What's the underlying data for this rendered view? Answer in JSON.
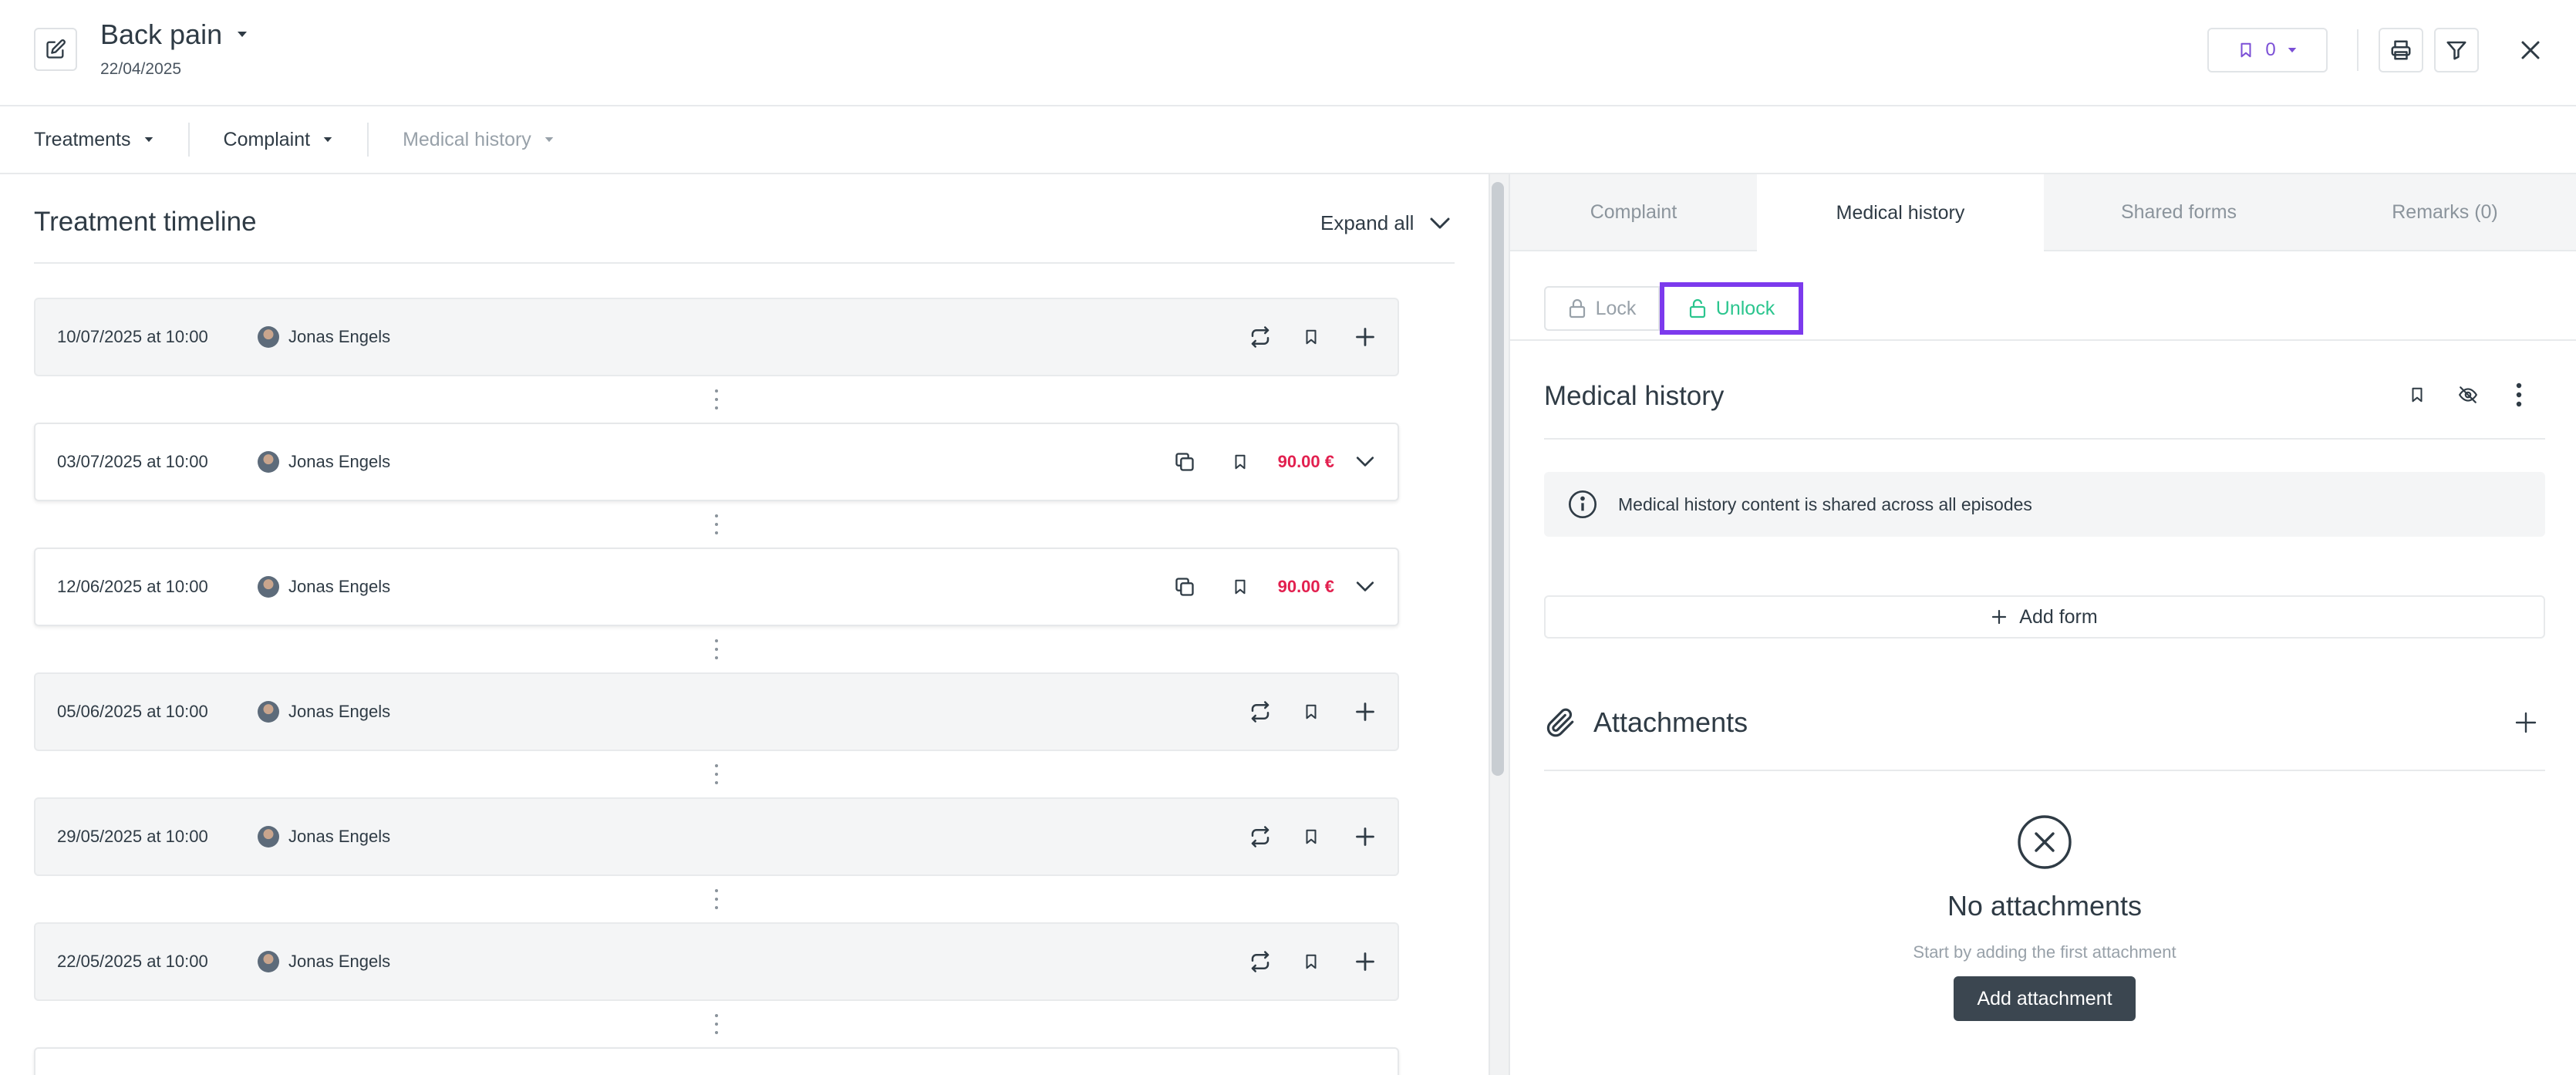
{
  "header": {
    "title": "Back pain",
    "date": "22/04/2025",
    "bookmark_count": "0"
  },
  "subnav": {
    "items": [
      {
        "label": "Treatments"
      },
      {
        "label": "Complaint"
      },
      {
        "label": "Medical history"
      }
    ]
  },
  "timeline": {
    "title": "Treatment timeline",
    "expand_all": "Expand all",
    "rows": [
      {
        "date": "10/07/2025 at 10:00",
        "practitioner": "Jonas Engels",
        "variant": "planned",
        "price": ""
      },
      {
        "date": "03/07/2025 at 10:00",
        "practitioner": "Jonas Engels",
        "variant": "done",
        "price": "90.00 €"
      },
      {
        "date": "12/06/2025 at 10:00",
        "practitioner": "Jonas Engels",
        "variant": "done",
        "price": "90.00 €"
      },
      {
        "date": "05/06/2025 at 10:00",
        "practitioner": "Jonas Engels",
        "variant": "planned",
        "price": ""
      },
      {
        "date": "29/05/2025 at 10:00",
        "practitioner": "Jonas Engels",
        "variant": "planned",
        "price": ""
      },
      {
        "date": "22/05/2025 at 10:00",
        "practitioner": "Jonas Engels",
        "variant": "planned",
        "price": ""
      }
    ]
  },
  "right_panel": {
    "tabs": [
      {
        "label": "Complaint"
      },
      {
        "label": "Medical history"
      },
      {
        "label": "Shared forms"
      },
      {
        "label": "Remarks (0)"
      }
    ],
    "active_tab": "Medical history",
    "lock_label": "Lock",
    "unlock_label": "Unlock",
    "section_title": "Medical history",
    "info_text": "Medical history content is shared across all episodes",
    "add_form_label": "Add form",
    "attachments_title": "Attachments",
    "empty_title": "No attachments",
    "empty_subtitle": "Start by adding the first attachment",
    "add_attachment_label": "Add attachment"
  },
  "colors": {
    "accent_purple": "#7c3aed",
    "price_red": "#e2204f",
    "unlock_green": "#2bc58e",
    "dark_button": "#3b4650"
  }
}
